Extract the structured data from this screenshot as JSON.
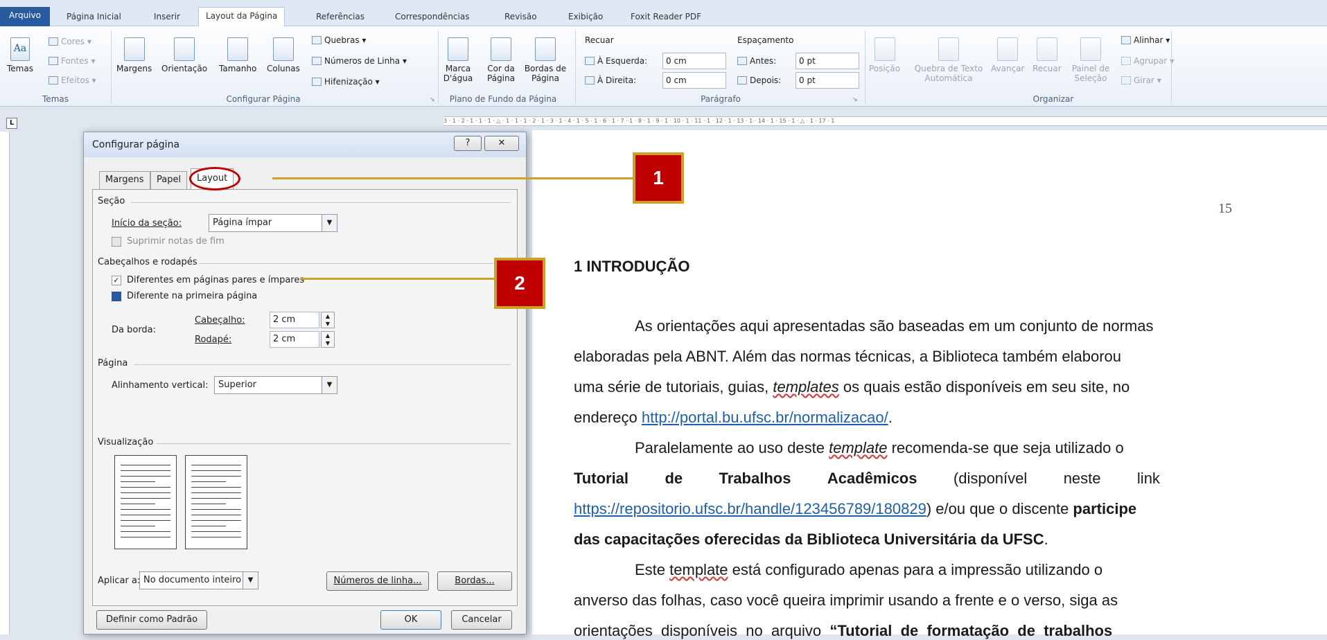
{
  "ribbon": {
    "tabs": [
      "Arquivo",
      "Página Inicial",
      "Inserir",
      "Layout da Página",
      "Referências",
      "Correspondências",
      "Revisão",
      "Exibição",
      "Foxit Reader PDF"
    ],
    "groups": {
      "temas": {
        "label": "Temas",
        "big": "Temas",
        "cores": "Cores",
        "fontes": "Fontes",
        "efeitos": "Efeitos"
      },
      "configurar": {
        "label": "Configurar Página",
        "margens": "Margens",
        "orientacao": "Orientação",
        "tamanho": "Tamanho",
        "colunas": "Colunas",
        "quebras": "Quebras",
        "numeros": "Números de Linha",
        "hifenizacao": "Hifenização"
      },
      "plano": {
        "label": "Plano de Fundo da Página",
        "marca": "Marca D'água",
        "cor": "Cor da Página",
        "bordas": "Bordas de Página"
      },
      "paragrafo": {
        "label": "Parágrafo",
        "recuar": "Recuar",
        "espacamento": "Espaçamento",
        "esquerda_label": "À Esquerda:",
        "esquerda_value": "0 cm",
        "direita_label": "À Direita:",
        "direita_value": "0 cm",
        "antes_label": "Antes:",
        "antes_value": "0 pt",
        "depois_label": "Depois:",
        "depois_value": "0 pt"
      },
      "organizar": {
        "label": "Organizar",
        "posicao": "Posição",
        "quebra": "Quebra de Texto Automática",
        "avancar": "Avançar",
        "recuar": "Recuar",
        "painel": "Painel de Seleção",
        "alinhar": "Alinhar",
        "agrupar": "Agrupar",
        "girar": "Girar"
      }
    }
  },
  "ruler": {
    "text": "3 · 1 · 2 · 1 · 1 · 1 · △ · 1 · 1 · 1 · 2 · 1 · 3 · 1 · 4 · 1 · 5 · 1 · 6 · 1 · 7 · 1 · 8 · 1 · 9 · 1 · 10 · 1 · 11 · 1 · 12 · 1 · 13 · 1 · 14 · 1 · 15 · 1 · △ · 1 · 17 · 1"
  },
  "dialog": {
    "title": "Configurar página",
    "help": "?",
    "close": "✕",
    "tabs": [
      "Margens",
      "Papel",
      "Layout"
    ],
    "secao": "Seção",
    "inicio_label": "Início da seção:",
    "inicio_value": "Página ímpar",
    "suprimir": "Suprimir notas de fim",
    "cabecalhos": "Cabeçalhos e rodapés",
    "diferentes_pares": "Diferentes em páginas pares e ímpares",
    "diferente_primeira": "Diferente na primeira página",
    "da_borda": "Da borda:",
    "cabecalho_label": "Cabeçalho:",
    "cabecalho_value": "2 cm",
    "rodape_label": "Rodapé:",
    "rodape_value": "2 cm",
    "pagina": "Página",
    "alinhamento_label": "Alinhamento vertical:",
    "alinhamento_value": "Superior",
    "visualizacao": "Visualização",
    "aplicar_label": "Aplicar a:",
    "aplicar_value": "No documento inteiro",
    "numeros_linha": "Números de linha...",
    "bordas": "Bordas...",
    "definir_padrao": "Definir como Padrão",
    "ok": "OK",
    "cancelar": "Cancelar"
  },
  "callouts": [
    "1",
    "2"
  ],
  "document": {
    "page_number": "15",
    "heading": "1 INTRODUÇÃO",
    "p1_l1": "As orientações aqui apresentadas são baseadas em um conjunto de normas",
    "p1_l2": "elaboradas pela ABNT. Além das normas técnicas, a Biblioteca também elaborou",
    "p1_l3_a": "uma série de tutoriais, guias, ",
    "p1_l3_em": "templates",
    "p1_l3_b": " os quais estão disponíveis em seu site, no",
    "p1_l4_a": "endereço ",
    "p1_l4_link": "http://portal.bu.ufsc.br/normalizacao/",
    "p1_l4_b": ".",
    "p2_l1_a": "Paralelamente ao uso deste ",
    "p2_l1_em": "template",
    "p2_l1_b": " recomenda-se que seja utilizado o",
    "p2_l2_w1": "Tutorial",
    "p2_l2_w2": "de",
    "p2_l2_w3": "Trabalhos",
    "p2_l2_w4": "Acadêmicos",
    "p2_l2_w5": "(disponível",
    "p2_l2_w6": "neste",
    "p2_l2_w7": "link",
    "p2_l3_link": "https://repositorio.ufsc.br/handle/123456789/180829",
    "p2_l3_a": ") e/ou que o discente ",
    "p2_l3_b": "participe",
    "p2_l4": "das capacitações oferecidas da Biblioteca Universitária da UFSC",
    "p2_l4_end": ".",
    "p3_l1_a": "Este ",
    "p3_l1_u": "template",
    "p3_l1_b": " está configurado apenas para a impressão utilizando o",
    "p3_l2": "anverso das folhas, caso você queira imprimir usando a frente e o verso, siga as",
    "p3_l3_a": "orientações  disponíveis  no  arquivo  ",
    "p3_l3_b": "“Tutorial  de  formatação  de  trabalhos"
  }
}
